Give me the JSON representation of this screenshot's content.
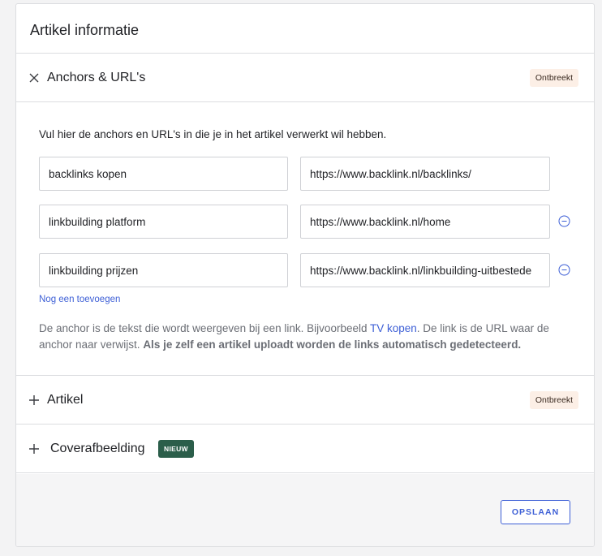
{
  "card": {
    "title": "Artikel informatie"
  },
  "sections": {
    "anchors": {
      "label": "Anchors & URL's",
      "badge": "Ontbreekt",
      "toggle_icon": "close-icon"
    },
    "artikel": {
      "label": "Artikel",
      "badge": "Ontbreekt",
      "toggle_icon": "plus-icon"
    },
    "cover": {
      "label": "Coverafbeelding",
      "badge": "NIEUW",
      "toggle_icon": "plus-icon"
    }
  },
  "anchors": {
    "intro": "Vul hier de anchors en URL's in die je in het artikel verwerkt wil hebben.",
    "rows": [
      {
        "anchor": "backlinks kopen",
        "url": "https://www.backlink.nl/backlinks/"
      },
      {
        "anchor": "linkbuilding platform",
        "url": "https://www.backlink.nl/home"
      },
      {
        "anchor": "linkbuilding prijzen",
        "url": "https://www.backlink.nl/linkbuilding-uitbestede"
      }
    ],
    "add_label": "Nog een toevoegen",
    "help": {
      "part1": "De anchor is de tekst die wordt weergeven bij een link. Bijvoorbeeld ",
      "link": "TV kopen",
      "part2": ". De link is de URL waar de anchor naar verwijst. ",
      "bold": "Als je zelf een artikel uploadt worden de links automatisch gedetecteerd."
    }
  },
  "footer": {
    "save_label": "OPSLAAN"
  },
  "colors": {
    "accent": "#3d5fd6",
    "badge_missing_bg": "#fcefe6",
    "badge_new_bg": "#2b5e4a"
  }
}
